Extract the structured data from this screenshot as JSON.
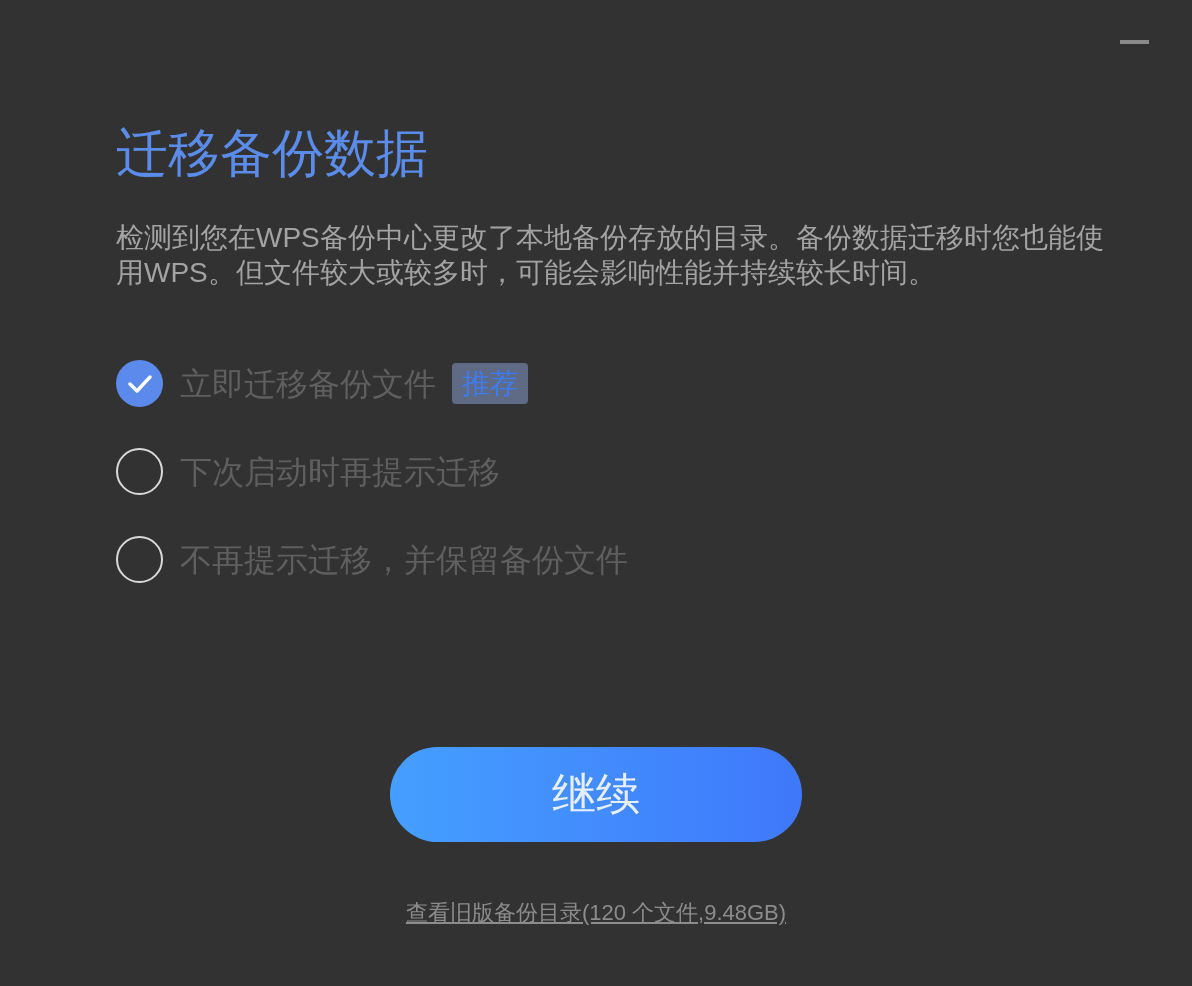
{
  "title": "迁移备份数据",
  "description": "检测到您在WPS备份中心更改了本地备份存放的目录。备份数据迁移时您也能使用WPS。但文件较大或较多时，可能会影响性能并持续较长时间。",
  "options": [
    {
      "label": "立即迁移备份文件",
      "selected": true,
      "badge": "推荐"
    },
    {
      "label": "下次启动时再提示迁移",
      "selected": false
    },
    {
      "label": "不再提示迁移，并保留备份文件",
      "selected": false
    }
  ],
  "primary_button": "继续",
  "link": "查看旧版备份目录(120 个文件,9.48GB)"
}
